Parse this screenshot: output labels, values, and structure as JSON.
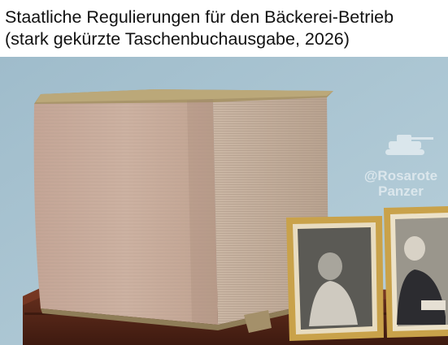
{
  "caption": {
    "line1": "Staatliche Regulierungen für den Bäckerei-Betrieb",
    "line2": "(stark gekürzte Taschenbuchausgabe, 2026)"
  },
  "watermark": {
    "line1": "@Rosarote",
    "line2": "Panzer",
    "icon": "tank-icon"
  },
  "colors": {
    "wall": "#a9c4d1",
    "book_pages": "#c9ad9c",
    "book_cover": "#b09a6b",
    "cabinet": "#5a2a1a",
    "frame_gold": "#c9a24a"
  }
}
